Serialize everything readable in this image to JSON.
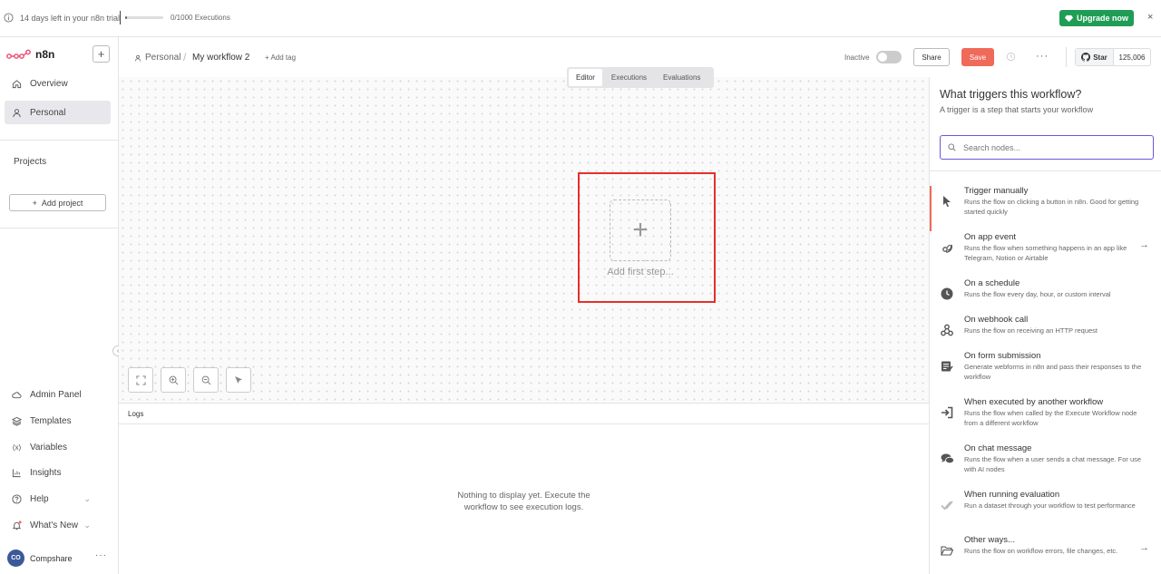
{
  "banner": {
    "trial_text": "14 days left in your n8n trial",
    "executions_text": "0/1000 Executions",
    "executions_used": 0,
    "executions_limit": 1000,
    "upgrade_label": "Upgrade now",
    "close_symbol": "×",
    "upgrade_color": "#1f9d55"
  },
  "sidebar": {
    "logo_text": "n8n",
    "add_symbol": "+",
    "items": [
      {
        "label": "Overview",
        "icon": "home-icon"
      },
      {
        "label": "Personal",
        "icon": "user-icon",
        "active": true
      }
    ],
    "projects_label": "Projects",
    "add_project_label": "Add project",
    "bottom_items": [
      {
        "label": "Admin Panel",
        "icon": "cloud-icon"
      },
      {
        "label": "Templates",
        "icon": "templates-icon"
      },
      {
        "label": "Variables",
        "icon": "variables-icon"
      },
      {
        "label": "Insights",
        "icon": "insights-icon"
      },
      {
        "label": "Help",
        "icon": "help-icon"
      },
      {
        "label": "What's New",
        "icon": "bell-icon"
      }
    ],
    "user_initials": "CO",
    "user_name": "Compshare",
    "more_symbol": "···"
  },
  "header": {
    "breadcrumb_project": "Personal",
    "workflow_title": "My workflow 2",
    "add_tag_label": "+ Add tag",
    "status_label": "Inactive",
    "share_label": "Share",
    "save_label": "Save",
    "more_symbol": "···",
    "github_star_label": "Star",
    "github_star_count": "125,006",
    "save_color": "#f06a5a"
  },
  "tabs": [
    {
      "label": "Editor",
      "active": true
    },
    {
      "label": "Executions"
    },
    {
      "label": "Evaluations"
    }
  ],
  "canvas": {
    "add_first_step_label": "Add first step...",
    "plus_symbol": "+"
  },
  "logs": {
    "title": "Logs",
    "empty_line1": "Nothing to display yet. Execute the",
    "empty_line2": "workflow to see execution logs."
  },
  "panel": {
    "title": "What triggers this workflow?",
    "subtitle": "A trigger is a step that starts your workflow",
    "search_placeholder": "Search nodes...",
    "triggers": [
      {
        "title": "Trigger manually",
        "desc": "Runs the flow on clicking a button in n8n. Good for getting started quickly",
        "icon": "cursor-icon"
      },
      {
        "title": "On app event",
        "desc": "Runs the flow when something happens in an app like Telegram, Notion or Airtable",
        "icon": "app-event-icon",
        "arrow": "→"
      },
      {
        "title": "On a schedule",
        "desc": "Runs the flow every day, hour, or custom interval",
        "icon": "clock-icon"
      },
      {
        "title": "On webhook call",
        "desc": "Runs the flow on receiving an HTTP request",
        "icon": "webhook-icon"
      },
      {
        "title": "On form submission",
        "desc": "Generate webforms in n8n and pass their responses to the workflow",
        "icon": "form-icon"
      },
      {
        "title": "When executed by another workflow",
        "desc": "Runs the flow when called by the Execute Workflow node from a different workflow",
        "icon": "sign-in-icon"
      },
      {
        "title": "On chat message",
        "desc": "Runs the flow when a user sends a chat message. For use with AI nodes",
        "icon": "chat-icon"
      },
      {
        "title": "When running evaluation",
        "desc": "Run a dataset through your workflow to test performance",
        "icon": "check-double-icon"
      },
      {
        "title": "Other ways...",
        "desc": "Runs the flow on workflow errors, file changes, etc.",
        "icon": "folder-open-icon",
        "arrow": "→"
      }
    ]
  }
}
